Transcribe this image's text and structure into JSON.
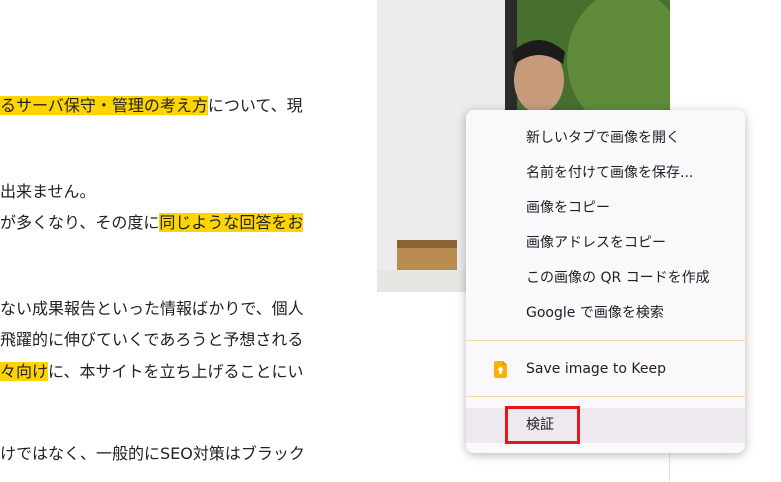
{
  "article": {
    "line1": {
      "hl": "るサーバ保守・管理の考え方",
      "rest": "について、現"
    },
    "line2": "出来ません。",
    "line3": {
      "pre": "が多くなり、その度に",
      "hl": "同じような回答をお"
    },
    "line4": "ない成果報告といった情報ばかりで、個人",
    "line5": "飛躍的に伸びていくであろうと予想される",
    "line6": {
      "hl": "々向け",
      "rest": "に、本サイトを立ち上げることにい"
    },
    "line7": "けではなく、一般的にSEO対策はブラック"
  },
  "context_menu": {
    "open_in_new_tab": "新しいタブで画像を開く",
    "save_as": "名前を付けて画像を保存...",
    "copy_image": "画像をコピー",
    "copy_address": "画像アドレスをコピー",
    "create_qr": "この画像の QR コードを作成",
    "google_search": "Google で画像を検索",
    "save_to_keep": "Save image to Keep",
    "inspect": "検証"
  },
  "colors": {
    "highlight": "#ffd400",
    "menu_bg": "#fbf8fb",
    "annotation_box": "#e4161b",
    "keep_icon": "#f6b400"
  },
  "icons": {
    "keep": "google-keep-icon"
  }
}
